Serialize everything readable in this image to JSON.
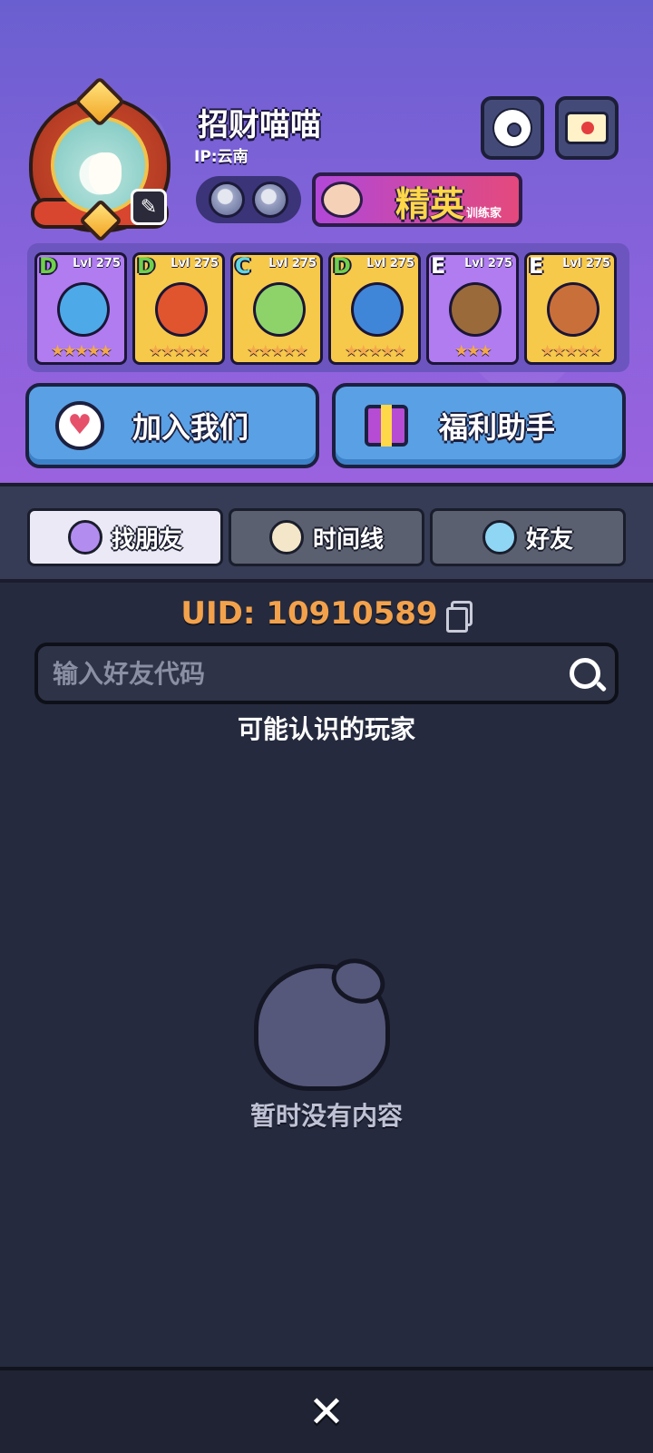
{
  "player": {
    "name": "招财喵喵",
    "ip": "IP:云南"
  },
  "title_badge": {
    "main": "精英",
    "sub": "训练家"
  },
  "icons": {
    "settings": "gear-icon",
    "mail": "mail-icon",
    "edit": "edit-icon",
    "close": "close-icon",
    "copy": "copy-icon",
    "search": "search-icon"
  },
  "pets": [
    {
      "rank": "D",
      "level": "Lvl 275",
      "stars": "★★★★★",
      "rank_color": "#6fd04a",
      "bg": "#b07cf0",
      "body": "#4da9e8"
    },
    {
      "rank": "D",
      "level": "Lvl 275",
      "stars": "★★★★★",
      "rank_color": "#6fd04a",
      "bg": "#f7c94a",
      "body": "#e0542e"
    },
    {
      "rank": "C",
      "level": "Lvl 275",
      "stars": "★★★★★",
      "rank_color": "#5fd6e0",
      "bg": "#f7c94a",
      "body": "#8dd36a"
    },
    {
      "rank": "D",
      "level": "Lvl 275",
      "stars": "★★★★★",
      "rank_color": "#6fd04a",
      "bg": "#f7c94a",
      "body": "#3f86d8"
    },
    {
      "rank": "E",
      "level": "Lvl 275",
      "stars": "★★★",
      "rank_color": "#ffffff",
      "bg": "#b07cf0",
      "body": "#9a6a3a"
    },
    {
      "rank": "E",
      "level": "Lvl 275",
      "stars": "★★★★★",
      "rank_color": "#ffffff",
      "bg": "#f7c94a",
      "body": "#c9703a"
    }
  ],
  "buttons": {
    "join": "加入我们",
    "welfare": "福利助手"
  },
  "tabs": [
    {
      "label": "找朋友",
      "active": true
    },
    {
      "label": "时间线",
      "active": false
    },
    {
      "label": "好友",
      "active": false
    }
  ],
  "main": {
    "uid": "UID: 10910589",
    "search_placeholder": "输入好友代码",
    "section_title": "可能认识的玩家",
    "empty_text": "暂时没有内容"
  },
  "colors": {
    "accent_uid": "#f3a24b",
    "header_purple": "#8a63dc",
    "button_blue": "#5aa0e4"
  }
}
